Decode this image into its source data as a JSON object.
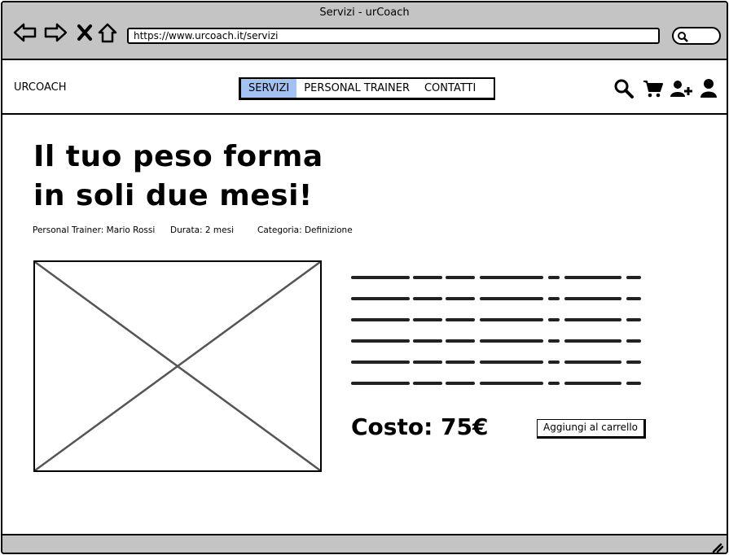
{
  "window": {
    "title": "Servizi - urCoach"
  },
  "browser": {
    "url": "https://www.urcoach.it/servizi",
    "nav_icons": [
      "back-arrow-icon",
      "forward-arrow-icon",
      "close-icon",
      "home-icon"
    ],
    "search_icon": "search-icon"
  },
  "header": {
    "brand": "URCOACH",
    "menu": [
      {
        "label": "SERVIZI",
        "active": true
      },
      {
        "label": "PERSONAL TRAINER",
        "active": false
      },
      {
        "label": "CONTATTI",
        "active": false
      }
    ],
    "icons": [
      "search-icon",
      "cart-icon",
      "add-user-icon",
      "user-icon"
    ]
  },
  "main": {
    "headline": "Il tuo peso forma in soli due mesi!",
    "meta": {
      "trainer": "Personal Trainer: Mario Rossi",
      "duration": "Durata: 2 mesi",
      "category": "Categoria: Definizione"
    },
    "price": "Costo: 75€",
    "add_to_cart": "Aggiungi al carrello"
  },
  "colors": {
    "chrome": "#c4c4c4",
    "menu_active": "#a3c1f2"
  }
}
